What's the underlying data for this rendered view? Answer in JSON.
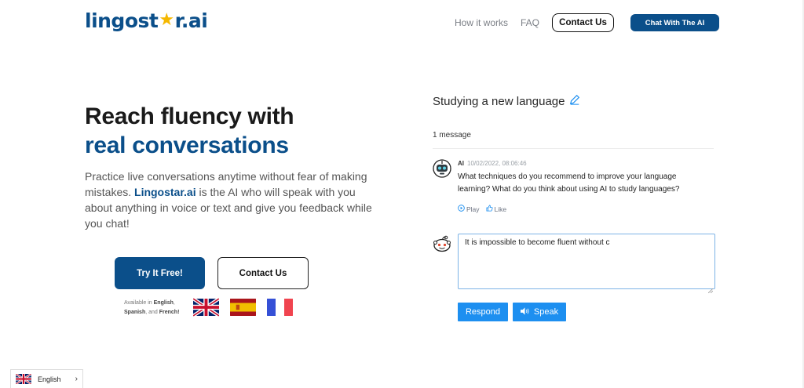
{
  "header": {
    "logo_prefix": "lingost",
    "logo_suffix": "r.ai",
    "nav": [
      {
        "label": "How it works"
      },
      {
        "label": "FAQ"
      }
    ],
    "contact_label": "Contact Us",
    "chat_label": "Chat With The AI"
  },
  "hero": {
    "title_line1": "Reach fluency with",
    "title_line2": "real conversations",
    "desc_before": "Practice live conversations anytime without fear of making mistakes. ",
    "desc_brand": "Lingostar.ai",
    "desc_after": " is the AI who will speak with you about anything in voice or text and give you feedback while you chat!",
    "try_label": "Try It Free!",
    "contact_label": "Contact Us",
    "available_prefix": "Available in ",
    "available_lang1": "English",
    "available_lang2": "Spanish",
    "available_mid": ", and ",
    "available_lang3": "French!",
    "available_comma": ","
  },
  "chat": {
    "title": "Studying a new language",
    "message_count": "1 message",
    "message": {
      "author": "AI",
      "timestamp": "10/02/2022, 08:06:46",
      "text": "What techniques do you recommend to improve your language learning? What do you think about using AI to study languages?",
      "play_label": "Play",
      "like_label": "Like"
    },
    "reply_value": "It is impossible to become fluent without c",
    "respond_label": "Respond",
    "speak_label": "Speak"
  },
  "language_switcher": {
    "selected": "English"
  },
  "colors": {
    "brand": "#0b4f8a",
    "star": "#f5b800",
    "action_blue": "#1d8ff0"
  }
}
